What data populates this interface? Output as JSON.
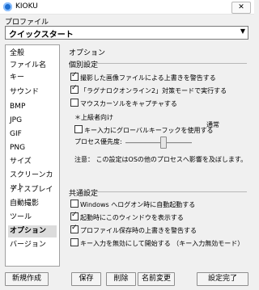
{
  "window": {
    "title": "KIOKU",
    "close_label": "✕"
  },
  "profile": {
    "label": "プロファイル",
    "selected": "クイックスタート"
  },
  "sidebar": {
    "items": [
      {
        "label": "全般"
      },
      {
        "label": "ファイル名"
      },
      {
        "label": "キー"
      },
      {
        "label": "サウンド"
      },
      {
        "label": "BMP"
      },
      {
        "label": "JPG"
      },
      {
        "label": "GIF"
      },
      {
        "label": "PNG"
      },
      {
        "label": "サイズ"
      },
      {
        "label": "スクリーンカット"
      },
      {
        "label": "ディスプレイ"
      },
      {
        "label": "自動撮影"
      },
      {
        "label": "ツール"
      },
      {
        "label": "オプション",
        "selected": true
      },
      {
        "label": "バージョン"
      }
    ]
  },
  "panel": {
    "title": "オプション",
    "individual": {
      "title": "個別設定",
      "opt1": {
        "label": "撮影した画像ファイルによる上書きを警告する",
        "checked": true
      },
      "opt2": {
        "label": "「ラグナロクオンライン2」対策モードで実行する",
        "checked": true
      },
      "opt3": {
        "label": "マウスカーソルをキャプチャする",
        "checked": false
      },
      "advanced_note": "＊上級者向け",
      "opt4": {
        "label": "キー入力にグローバルキーフックを使用する",
        "checked": false
      },
      "priority": {
        "label": "プロセス優先度:",
        "value_label": "通常",
        "level": 0.5
      },
      "caution": "注意： この設定はOSの他のプロセスへ影響を及ぼします。"
    },
    "common": {
      "title": "共通設定",
      "opt1": {
        "label": "Windows へログオン時に自動起動する",
        "checked": false
      },
      "opt2": {
        "label": "起動時にこのウィンドウを表示する",
        "checked": true
      },
      "opt3": {
        "label": "プロファイル保存時の上書きを警告する",
        "checked": true
      },
      "opt4": {
        "label": "キー入力を無効にして開始する （キー入力無効モード）",
        "checked": false
      }
    }
  },
  "buttons": {
    "new": "新規作成",
    "save": "保存",
    "delete": "削除",
    "rename": "名前変更",
    "done": "設定完了"
  }
}
